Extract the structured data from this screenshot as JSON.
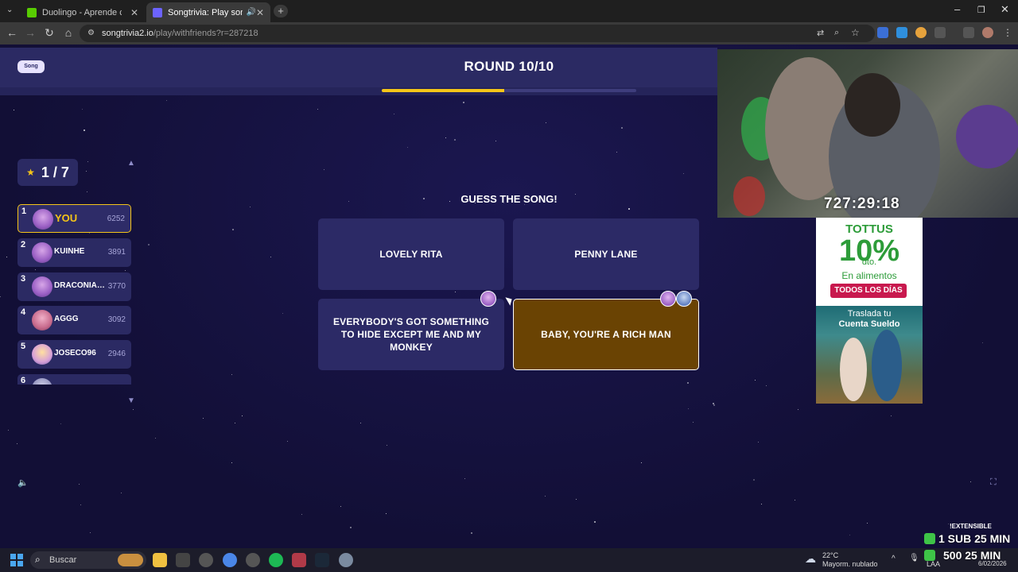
{
  "browser": {
    "tabs": [
      {
        "title": "Duolingo - Aprende con leccio...",
        "active": false
      },
      {
        "title": "Songtrivia: Play song quizze...",
        "active": true
      }
    ],
    "new_tab": "+",
    "url_host": "songtrivia2.io",
    "url_path": "/play/withfriends?r=287218"
  },
  "game": {
    "logo_text": "Song Trivia",
    "round": "ROUND 10/10",
    "progress_fraction": 0.48,
    "place_text": "1 / 7",
    "question": "GUESS THE SONG!",
    "answers": [
      {
        "label": "LOVELY RITA",
        "selected": false
      },
      {
        "label": "PENNY LANE",
        "selected": false
      },
      {
        "label": "EVERYBODY'S GOT SOMETHING TO HIDE EXCEPT ME AND MY MONKEY",
        "selected": false
      },
      {
        "label": "BABY, YOU'RE A RICH MAN",
        "selected": true
      }
    ],
    "leaderboard": [
      {
        "rank": "1",
        "name": "YOU",
        "score": "6252"
      },
      {
        "rank": "2",
        "name": "KUINHE",
        "score": "3891"
      },
      {
        "rank": "3",
        "name": "DRACONIAN...",
        "score": "3770"
      },
      {
        "rank": "4",
        "name": "AGGG",
        "score": "3092"
      },
      {
        "rank": "5",
        "name": "JOSECO96",
        "score": "2946"
      },
      {
        "rank": "6",
        "name": "",
        "score": ""
      }
    ]
  },
  "stream": {
    "timer": "727:29:18",
    "ad": {
      "brand": "TOTTUS",
      "percent": "10%",
      "percent_sub": "dto.",
      "line1": "En alimentos",
      "badge": "TODOS LOS DÍAS",
      "line2": "Traslada tu",
      "line3": "Cuenta Sueldo"
    },
    "subs_label": "!EXTENSIBLE",
    "subs_line1": "1 SUB 25 MIN",
    "subs_line2": "500 25 MIN"
  },
  "taskbar": {
    "search_placeholder": "Buscar",
    "weather_temp": "22°C",
    "weather_desc": "Mayorm. nublado",
    "lang": "LAA",
    "date": "6/02/2026"
  },
  "colors": {
    "accent_yellow": "#f5c518",
    "panel": "#2b2a63",
    "selected_answer": "#6a4303",
    "background": "#14113a"
  }
}
